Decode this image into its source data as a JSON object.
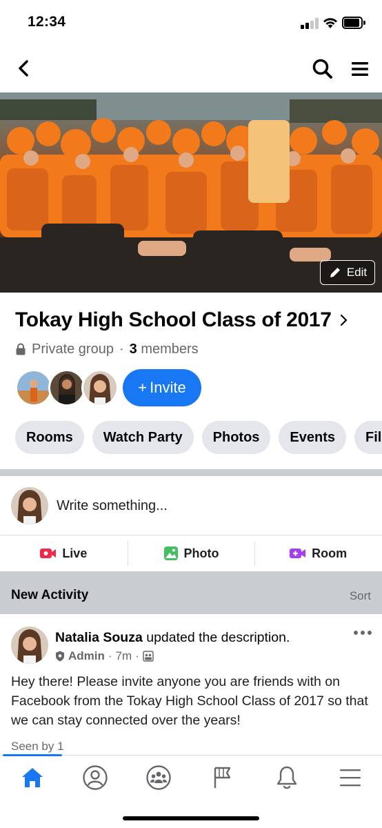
{
  "status_bar": {
    "time": "12:34"
  },
  "group": {
    "title": "Tokay High School Class of 2017",
    "privacy": "Private group",
    "separator": "·",
    "member_count": "3",
    "members_label": "members",
    "edit_label": "Edit"
  },
  "invite": {
    "plus": "+",
    "label": "Invite"
  },
  "chips": [
    "Rooms",
    "Watch Party",
    "Photos",
    "Events",
    "Files"
  ],
  "composer": {
    "placeholder": "Write something..."
  },
  "actions": {
    "live": "Live",
    "photo": "Photo",
    "room": "Room"
  },
  "activity": {
    "title": "New Activity",
    "sort": "Sort"
  },
  "post": {
    "author": "Natalia Souza",
    "action": "updated the description.",
    "role": "Admin",
    "time": "7m",
    "separator": "·",
    "body": "Hey there! Please invite anyone you are friends with on Facebook from the Tokay High School Class of 2017 so that we can stay connected over the years!",
    "seen_by": "Seen by 1"
  },
  "colors": {
    "brand_blue": "#1877f2",
    "live_red": "#f02849",
    "photo_green": "#45bd62",
    "room_purple": "#a33ef2",
    "chip_gray": "#e4e6eb",
    "divider_gray": "#c9ccd1",
    "cover_orange": "#f27a1a"
  },
  "icons": {
    "nav": [
      "back-chevron-icon",
      "search-icon",
      "menu-icon"
    ],
    "tabs": [
      "home-icon",
      "profile-icon",
      "groups-icon",
      "pages-flag-icon",
      "notifications-bell-icon",
      "menu-icon"
    ]
  }
}
